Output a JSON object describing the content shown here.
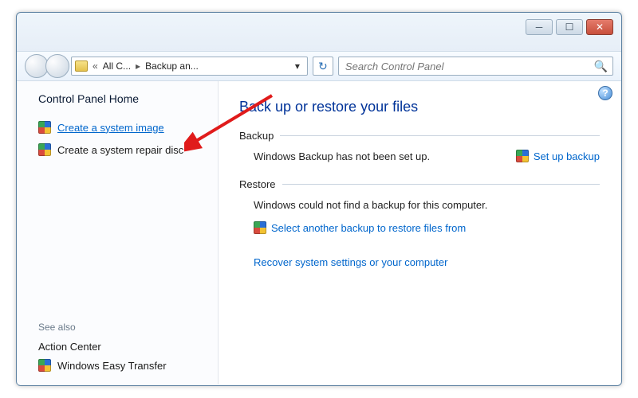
{
  "titlebar": {
    "minimize_glyph": "─",
    "maximize_glyph": "☐",
    "close_glyph": "✕"
  },
  "toolbar": {
    "back_glyph": "",
    "forward_glyph": "",
    "breadcrumb_prefix": "«",
    "breadcrumb_part1": "All C...",
    "breadcrumb_sep": "▸",
    "breadcrumb_part2": "Backup an...",
    "address_drop": "▾",
    "refresh_glyph": "↻",
    "search_placeholder": "Search Control Panel",
    "search_glyph": "🔍"
  },
  "sidebar": {
    "home": "Control Panel Home",
    "link_create_image": "Create a system image",
    "link_create_disc": "Create a system repair disc",
    "see_also": "See also",
    "action_center": "Action Center",
    "easy_transfer": "Windows Easy Transfer"
  },
  "main": {
    "help_glyph": "?",
    "heading": "Back up or restore your files",
    "backup_title": "Backup",
    "backup_msg": "Windows Backup has not been set up.",
    "backup_action": "Set up backup",
    "restore_title": "Restore",
    "restore_msg": "Windows could not find a backup for this computer.",
    "restore_select": "Select another backup to restore files from",
    "recover_link": "Recover system settings or your computer"
  }
}
